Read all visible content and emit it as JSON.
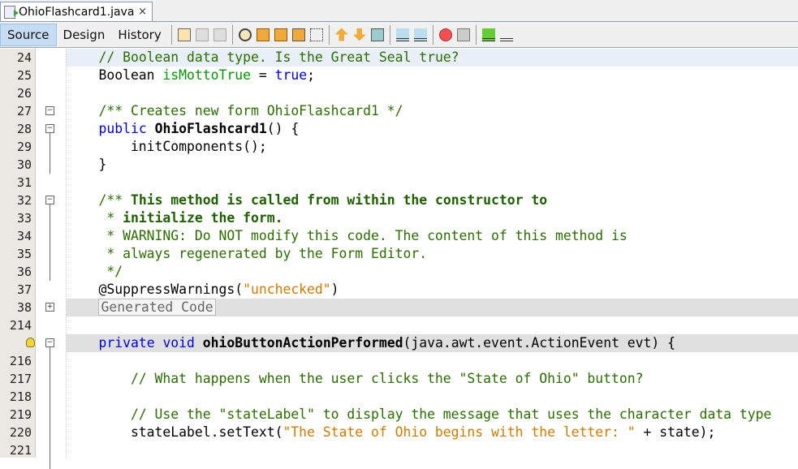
{
  "tab": {
    "title": "OhioFlashcard1.java",
    "close": "×",
    "icon": "java-file-icon"
  },
  "views": [
    "Source",
    "Design",
    "History"
  ],
  "active_view": "Source",
  "toolbar_icons": [
    "last-edit-icon",
    "back-icon",
    "forward-icon",
    "find-icon",
    "find-previous-icon",
    "find-next-icon",
    "toggle-highlight-icon",
    "toggle-rect-selection-icon",
    "previous-bookmark-icon",
    "next-bookmark-icon",
    "toggle-bookmark-icon",
    "shift-left-icon",
    "shift-right-icon",
    "record-macro-icon",
    "stop-macro-icon",
    "comment-icon",
    "uncomment-icon"
  ],
  "lines": [
    {
      "n": "24",
      "cur": true,
      "t": [
        [
          "    ",
          ""
        ],
        [
          "// Boolean data type. Is the Great Seal true?",
          "cm"
        ]
      ]
    },
    {
      "n": "25",
      "t": [
        [
          "    Boolean ",
          ""
        ],
        [
          "isMottoTrue",
          "var"
        ],
        [
          " = ",
          ""
        ],
        [
          "true",
          "kw"
        ],
        [
          ";",
          ""
        ]
      ]
    },
    {
      "n": "26",
      "t": []
    },
    {
      "n": "27",
      "fold": "minus",
      "t": [
        [
          "    ",
          ""
        ],
        [
          "/** Creates new form OhioFlashcard1 */",
          "cm"
        ]
      ]
    },
    {
      "n": "28",
      "fold": "minus",
      "t": [
        [
          "    ",
          ""
        ],
        [
          "public",
          "kw"
        ],
        [
          " ",
          ""
        ],
        [
          "OhioFlashcard1",
          "b"
        ],
        [
          "() {",
          ""
        ]
      ]
    },
    {
      "n": "29",
      "t": [
        [
          "        initComponents();",
          ""
        ]
      ]
    },
    {
      "n": "30",
      "t": [
        [
          "    }",
          ""
        ]
      ]
    },
    {
      "n": "31",
      "t": []
    },
    {
      "n": "32",
      "fold": "minus",
      "t": [
        [
          "    ",
          ""
        ],
        [
          "/** ",
          "cm"
        ],
        [
          "This method is called from within the constructor to",
          "cmb"
        ]
      ]
    },
    {
      "n": "33",
      "t": [
        [
          "     ",
          ""
        ],
        [
          "* ",
          "cm"
        ],
        [
          "initialize the form.",
          "cmb"
        ]
      ]
    },
    {
      "n": "34",
      "t": [
        [
          "     ",
          ""
        ],
        [
          "* WARNING: Do NOT modify this code. The content of this method is",
          "cm"
        ]
      ]
    },
    {
      "n": "35",
      "t": [
        [
          "     ",
          ""
        ],
        [
          "* always regenerated by the Form Editor.",
          "cm"
        ]
      ]
    },
    {
      "n": "36",
      "t": [
        [
          "     ",
          ""
        ],
        [
          "*/",
          "cm"
        ]
      ]
    },
    {
      "n": "37",
      "t": [
        [
          "    @SuppressWarnings(",
          ""
        ],
        [
          "\"unchecked\"",
          "str"
        ],
        [
          ")",
          ""
        ]
      ]
    },
    {
      "n": "38",
      "fold": "plus",
      "folded": true,
      "t": [
        [
          "    ",
          ""
        ],
        [
          "Generated Code",
          "gen"
        ]
      ]
    },
    {
      "n": "214",
      "t": []
    },
    {
      "n": "",
      "fold": "minus",
      "folded": true,
      "bulb": true,
      "t": [
        [
          "    ",
          ""
        ],
        [
          "private",
          "kw"
        ],
        [
          " ",
          ""
        ],
        [
          "void",
          "kw"
        ],
        [
          " ",
          ""
        ],
        [
          "ohioButtonActionPerformed",
          "b"
        ],
        [
          "(java.awt.event.ActionEvent evt) {",
          ""
        ]
      ]
    },
    {
      "n": "216",
      "t": []
    },
    {
      "n": "217",
      "t": [
        [
          "        ",
          ""
        ],
        [
          "// What happens when the user clicks the \"State of Ohio\" button?",
          "cm"
        ]
      ]
    },
    {
      "n": "218",
      "t": []
    },
    {
      "n": "219",
      "t": [
        [
          "        ",
          ""
        ],
        [
          "// Use the \"stateLabel\" to display the message that uses the character data type",
          "cm"
        ]
      ]
    },
    {
      "n": "220",
      "t": [
        [
          "        stateLabel.setText(",
          ""
        ],
        [
          "\"The State of Ohio begins with the letter: \"",
          "str"
        ],
        [
          " + state);",
          ""
        ]
      ]
    },
    {
      "n": "221",
      "t": []
    }
  ]
}
